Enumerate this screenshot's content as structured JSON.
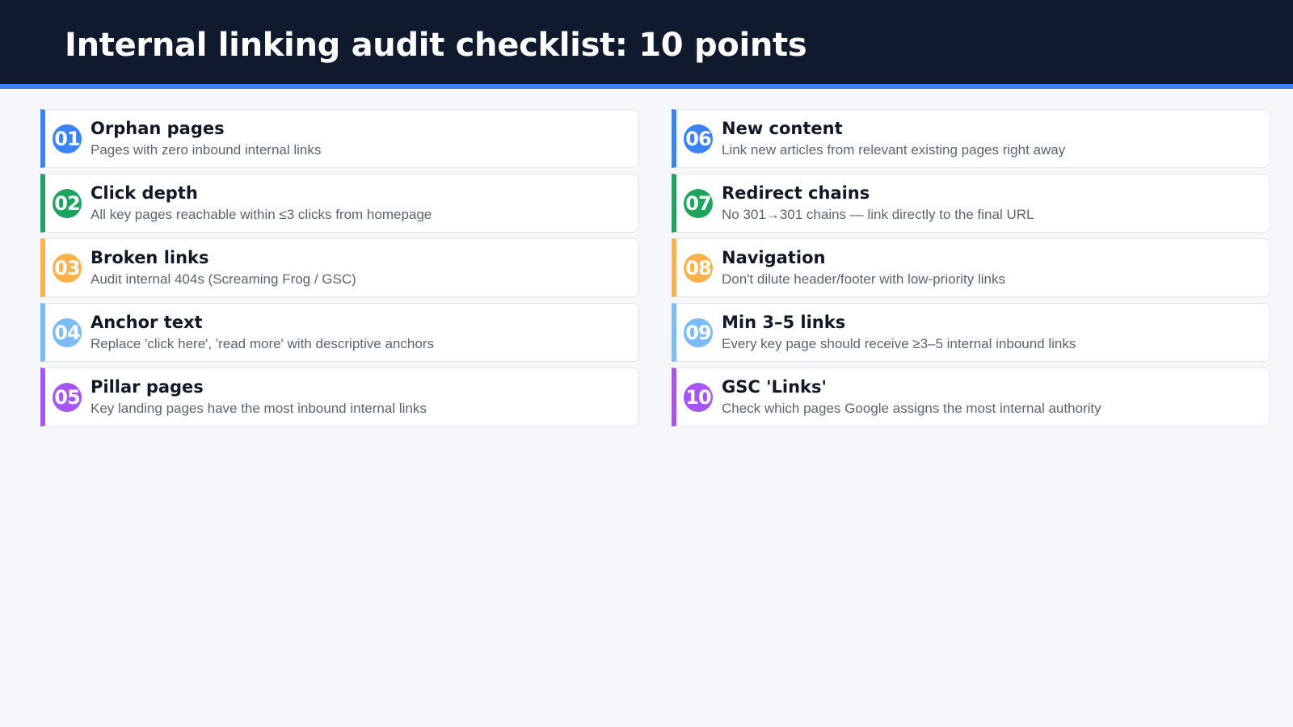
{
  "header": {
    "title": "Internal linking audit checklist: 10 points"
  },
  "colors": {
    "header_bg": "#0f1a2e",
    "accent": "#3b82f6",
    "blue": "#3b82f6",
    "green": "#1fa35e",
    "orange": "#fbb24c",
    "light_blue": "#7cbcf5",
    "purple": "#a855f7"
  },
  "checklist": {
    "left": [
      {
        "num": "01",
        "title": "Orphan pages",
        "desc": "Pages with zero inbound internal links",
        "color": "#3b82f6"
      },
      {
        "num": "02",
        "title": "Click depth",
        "desc": "All key pages reachable within ≤3 clicks from homepage",
        "color": "#1fa35e"
      },
      {
        "num": "03",
        "title": "Broken links",
        "desc": "Audit internal 404s (Screaming Frog / GSC)",
        "color": "#fbb24c"
      },
      {
        "num": "04",
        "title": "Anchor text",
        "desc": "Replace 'click here', 'read more' with descriptive anchors",
        "color": "#7cbcf5"
      },
      {
        "num": "05",
        "title": "Pillar pages",
        "desc": "Key landing pages have the most inbound internal links",
        "color": "#a855f7"
      }
    ],
    "right": [
      {
        "num": "06",
        "title": "New content",
        "desc": "Link new articles from relevant existing pages right away",
        "color": "#3b82f6"
      },
      {
        "num": "07",
        "title": "Redirect chains",
        "desc": "No 301→301 chains — link directly to the final URL",
        "color": "#1fa35e"
      },
      {
        "num": "08",
        "title": "Navigation",
        "desc": "Don't dilute header/footer with low-priority links",
        "color": "#fbb24c"
      },
      {
        "num": "09",
        "title": "Min 3–5 links",
        "desc": "Every key page should receive ≥3–5 internal inbound links",
        "color": "#7cbcf5"
      },
      {
        "num": "10",
        "title": "GSC 'Links'",
        "desc": "Check which pages Google assigns the most internal authority",
        "color": "#a855f7"
      }
    ]
  }
}
